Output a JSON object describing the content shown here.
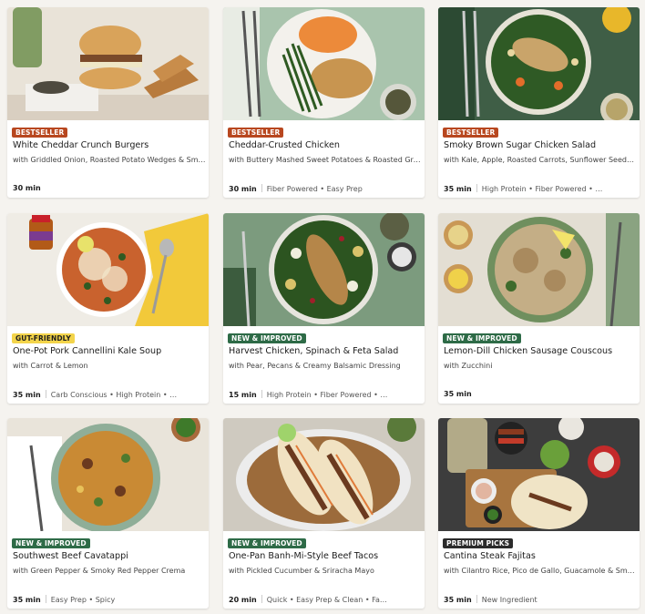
{
  "colors": {
    "bestseller": "#b8471f",
    "gut_friendly": "#f3d44b",
    "new_improved": "#2e6b47",
    "premium_picks": "#2b2b2b"
  },
  "cards": [
    {
      "badge": "BESTSELLER",
      "badge_type": "bestseller",
      "title": "White Cheddar Crunch Burgers",
      "subtitle": "with Griddled Onion, Roasted Potato Wedges & Smo…",
      "time": "30 min",
      "tags": ""
    },
    {
      "badge": "BESTSELLER",
      "badge_type": "bestseller",
      "title": "Cheddar-Crusted Chicken",
      "subtitle": "with Buttery Mashed Sweet Potatoes & Roasted Gre…",
      "time": "30 min",
      "tags": "Fiber Powered • Easy Prep"
    },
    {
      "badge": "BESTSELLER",
      "badge_type": "bestseller",
      "title": "Smoky Brown Sugar Chicken Salad",
      "subtitle": "with Kale, Apple, Roasted Carrots, Sunflower Seeds …",
      "time": "35 min",
      "tags": "High Protein • Fiber Powered • …"
    },
    {
      "badge": "GUT-FRIENDLY",
      "badge_type": "gut_friendly",
      "title": "One-Pot Pork Cannellini Kale Soup",
      "subtitle": "with Carrot & Lemon",
      "time": "35 min",
      "tags": "Carb Conscious • High Protein • …"
    },
    {
      "badge": "NEW & IMPROVED",
      "badge_type": "new_improved",
      "title": "Harvest Chicken, Spinach & Feta Salad",
      "subtitle": "with Pear, Pecans & Creamy Balsamic Dressing",
      "time": "15 min",
      "tags": "High Protein • Fiber Powered • …"
    },
    {
      "badge": "NEW & IMPROVED",
      "badge_type": "new_improved",
      "title": "Lemon-Dill Chicken Sausage Couscous",
      "subtitle": "with Zucchini",
      "time": "35 min",
      "tags": ""
    },
    {
      "badge": "NEW & IMPROVED",
      "badge_type": "new_improved",
      "title": "Southwest Beef Cavatappi",
      "subtitle": "with Green Pepper & Smoky Red Pepper Crema",
      "time": "35 min",
      "tags": "Easy Prep • Spicy"
    },
    {
      "badge": "NEW & IMPROVED",
      "badge_type": "new_improved",
      "title": "One-Pan Banh-Mi-Style Beef Tacos",
      "subtitle": "with Pickled Cucumber & Sriracha Mayo",
      "time": "20 min",
      "tags": "Quick • Easy Prep & Clean • Fa…"
    },
    {
      "badge": "PREMIUM PICKS",
      "badge_type": "premium_picks",
      "title": "Cantina Steak Fajitas",
      "subtitle": "with Cilantro Rice, Pico de Gallo, Guacamole & Sm…",
      "time": "35 min",
      "tags": "New Ingredient"
    }
  ]
}
